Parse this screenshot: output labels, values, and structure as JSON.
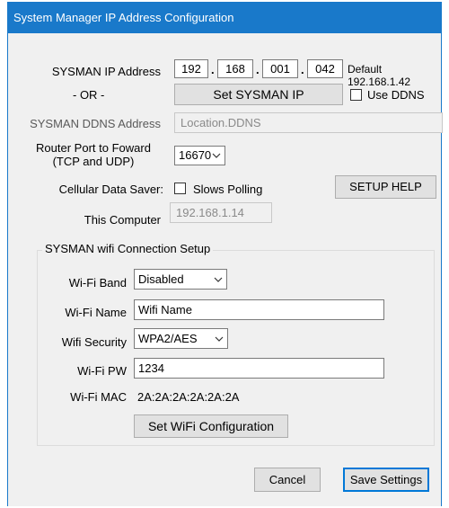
{
  "window": {
    "title": "System Manager IP Address Configuration"
  },
  "ip": {
    "label": "SYSMAN IP Address",
    "octets": [
      "192",
      "168",
      "001",
      "042"
    ],
    "separator": ".",
    "default_text": "Default 192.168.1.42"
  },
  "or_text": "- OR -",
  "set_ip_button": "Set SYSMAN IP",
  "use_ddns": {
    "label": "Use DDNS",
    "checked": false
  },
  "ddns": {
    "label": "SYSMAN DDNS Address",
    "value": "Location.DDNS"
  },
  "router_port": {
    "label_line1": "Router Port to Foward",
    "label_line2": "(TCP and UDP)",
    "value": "16670"
  },
  "cellular": {
    "label": "Cellular Data Saver:",
    "checkbox_label": "Slows Polling",
    "checked": false
  },
  "setup_help_button": "SETUP HELP",
  "this_computer": {
    "label": "This Computer",
    "value": "192.168.1.14"
  },
  "wifi": {
    "group_title": "SYSMAN wifi Connection Setup",
    "band_label": "Wi-Fi Band",
    "band_value": "Disabled",
    "name_label": "Wi-Fi Name",
    "name_value": "Wifi Name",
    "security_label": "Wifi Security",
    "security_value": "WPA2/AES",
    "pw_label": "Wi-Fi PW",
    "pw_value": "1234",
    "mac_label": "Wi-Fi MAC",
    "mac_value": "2A:2A:2A:2A:2A:2A",
    "set_button": "Set WiFi Configuration"
  },
  "cancel_button": "Cancel",
  "save_button": "Save Settings",
  "colors": {
    "titlebar": "#1979ca",
    "dialog_bg": "#f0f0f0",
    "default_button_border": "#0078d7"
  }
}
